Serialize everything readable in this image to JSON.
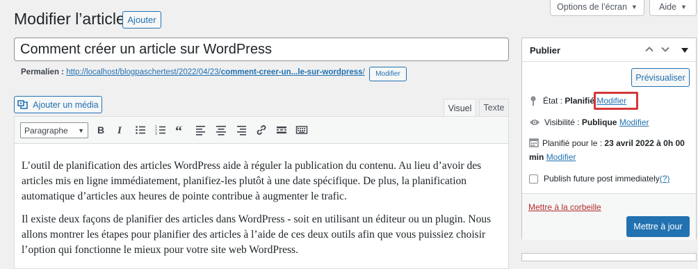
{
  "screen_options": {
    "label": "Options de l’écran",
    "help_label": "Aide"
  },
  "page": {
    "title": "Modifier l’article",
    "add_button": "Ajouter"
  },
  "post": {
    "title": "Comment créer un article sur WordPress"
  },
  "permalink": {
    "label": "Permalien :",
    "url_base": "http://localhost/blogpaschertest/2022/04/23/",
    "url_slug": "comment-creer-un...le-sur-wordpress",
    "url_end": "/",
    "edit_button": "Modifier"
  },
  "media": {
    "button_label": "Ajouter un média"
  },
  "editor_tabs": {
    "visual": "Visuel",
    "text": "Texte"
  },
  "toolbar": {
    "format_select": "Paragraphe",
    "icons": [
      "bold-icon",
      "italic-icon",
      "bullet-list-icon",
      "numbered-list-icon",
      "blockquote-icon",
      "align-left-icon",
      "align-center-icon",
      "align-right-icon",
      "link-icon",
      "read-more-icon",
      "toolbar-toggle-icon"
    ]
  },
  "content": {
    "paragraphs": [
      "L’outil de planification des articles WordPress aide à réguler la publication du contenu. Au lieu d’avoir des articles mis en ligne immédiatement, planifiez-les plutôt à une date spécifique. De plus, la planification automatique d’articles aux heures de pointe contribue à augmenter le trafic.",
      "Il existe deux façons de planifier des articles dans WordPress - soit en utilisant un éditeur ou un plugin. Nous allons montrer les étapes pour planifier des articles à l’aide de ces deux outils afin que vous puissiez choisir l’option qui fonctionne le mieux pour votre site web WordPress."
    ]
  },
  "publish": {
    "title": "Publier",
    "preview_button": "Prévisualiser",
    "status_label": "État :",
    "status_value": "Planifié",
    "status_edit": "Modifier",
    "visibility_label": "Visibilité :",
    "visibility_value": "Publique",
    "visibility_edit": "Modifier",
    "schedule_label": "Planifié pour le :",
    "schedule_value": "23 avril 2022 à 0h 00 min",
    "schedule_edit": "Modifier",
    "future_checkbox_label": "Publish future post immediately",
    "future_help": "(?)",
    "trash_link": "Mettre à la corbeille",
    "update_button": "Mettre à jour",
    "accent_color": "#2271b1",
    "highlight_color": "#d63638"
  }
}
